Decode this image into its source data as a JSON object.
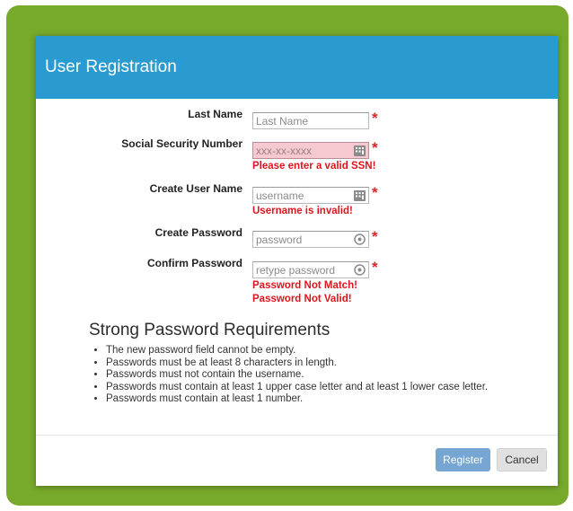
{
  "dialog": {
    "title": "User Registration"
  },
  "form": {
    "last_name": {
      "label": "Last Name",
      "placeholder": "Last Name",
      "required_mark": "*"
    },
    "ssn": {
      "label": "Social Security Number",
      "placeholder": "xxx-xx-xxxx",
      "required_mark": "*",
      "error": "Please enter a valid SSN!",
      "icon": "keypad-icon"
    },
    "username": {
      "label": "Create User Name",
      "placeholder": "username",
      "required_mark": "*",
      "error": "Username is invalid!",
      "icon": "keypad-icon"
    },
    "password": {
      "label": "Create Password",
      "placeholder": "password",
      "required_mark": "*",
      "icon": "password-reveal-icon"
    },
    "confirm_password": {
      "label": "Confirm Password",
      "placeholder": "retype password",
      "required_mark": "*",
      "errors": [
        "Password Not Match!",
        "Password Not Valid!"
      ],
      "icon": "password-reveal-icon"
    }
  },
  "requirements": {
    "heading": "Strong Password Requirements",
    "items": [
      "The new password field cannot be empty.",
      "Passwords must be at least 8 characters in length.",
      "Passwords must not contain the username.",
      "Passwords must contain at least 1 upper case letter and at least 1 lower case letter.",
      "Passwords must contain at least 1 number."
    ]
  },
  "buttons": {
    "register": "Register",
    "cancel": "Cancel"
  },
  "colors": {
    "frame": "#77a92b",
    "header": "#2a9bd1",
    "error": "#e0141e",
    "invalid_field_bg": "#f6c8cf",
    "register_button": "#76a6d1"
  }
}
